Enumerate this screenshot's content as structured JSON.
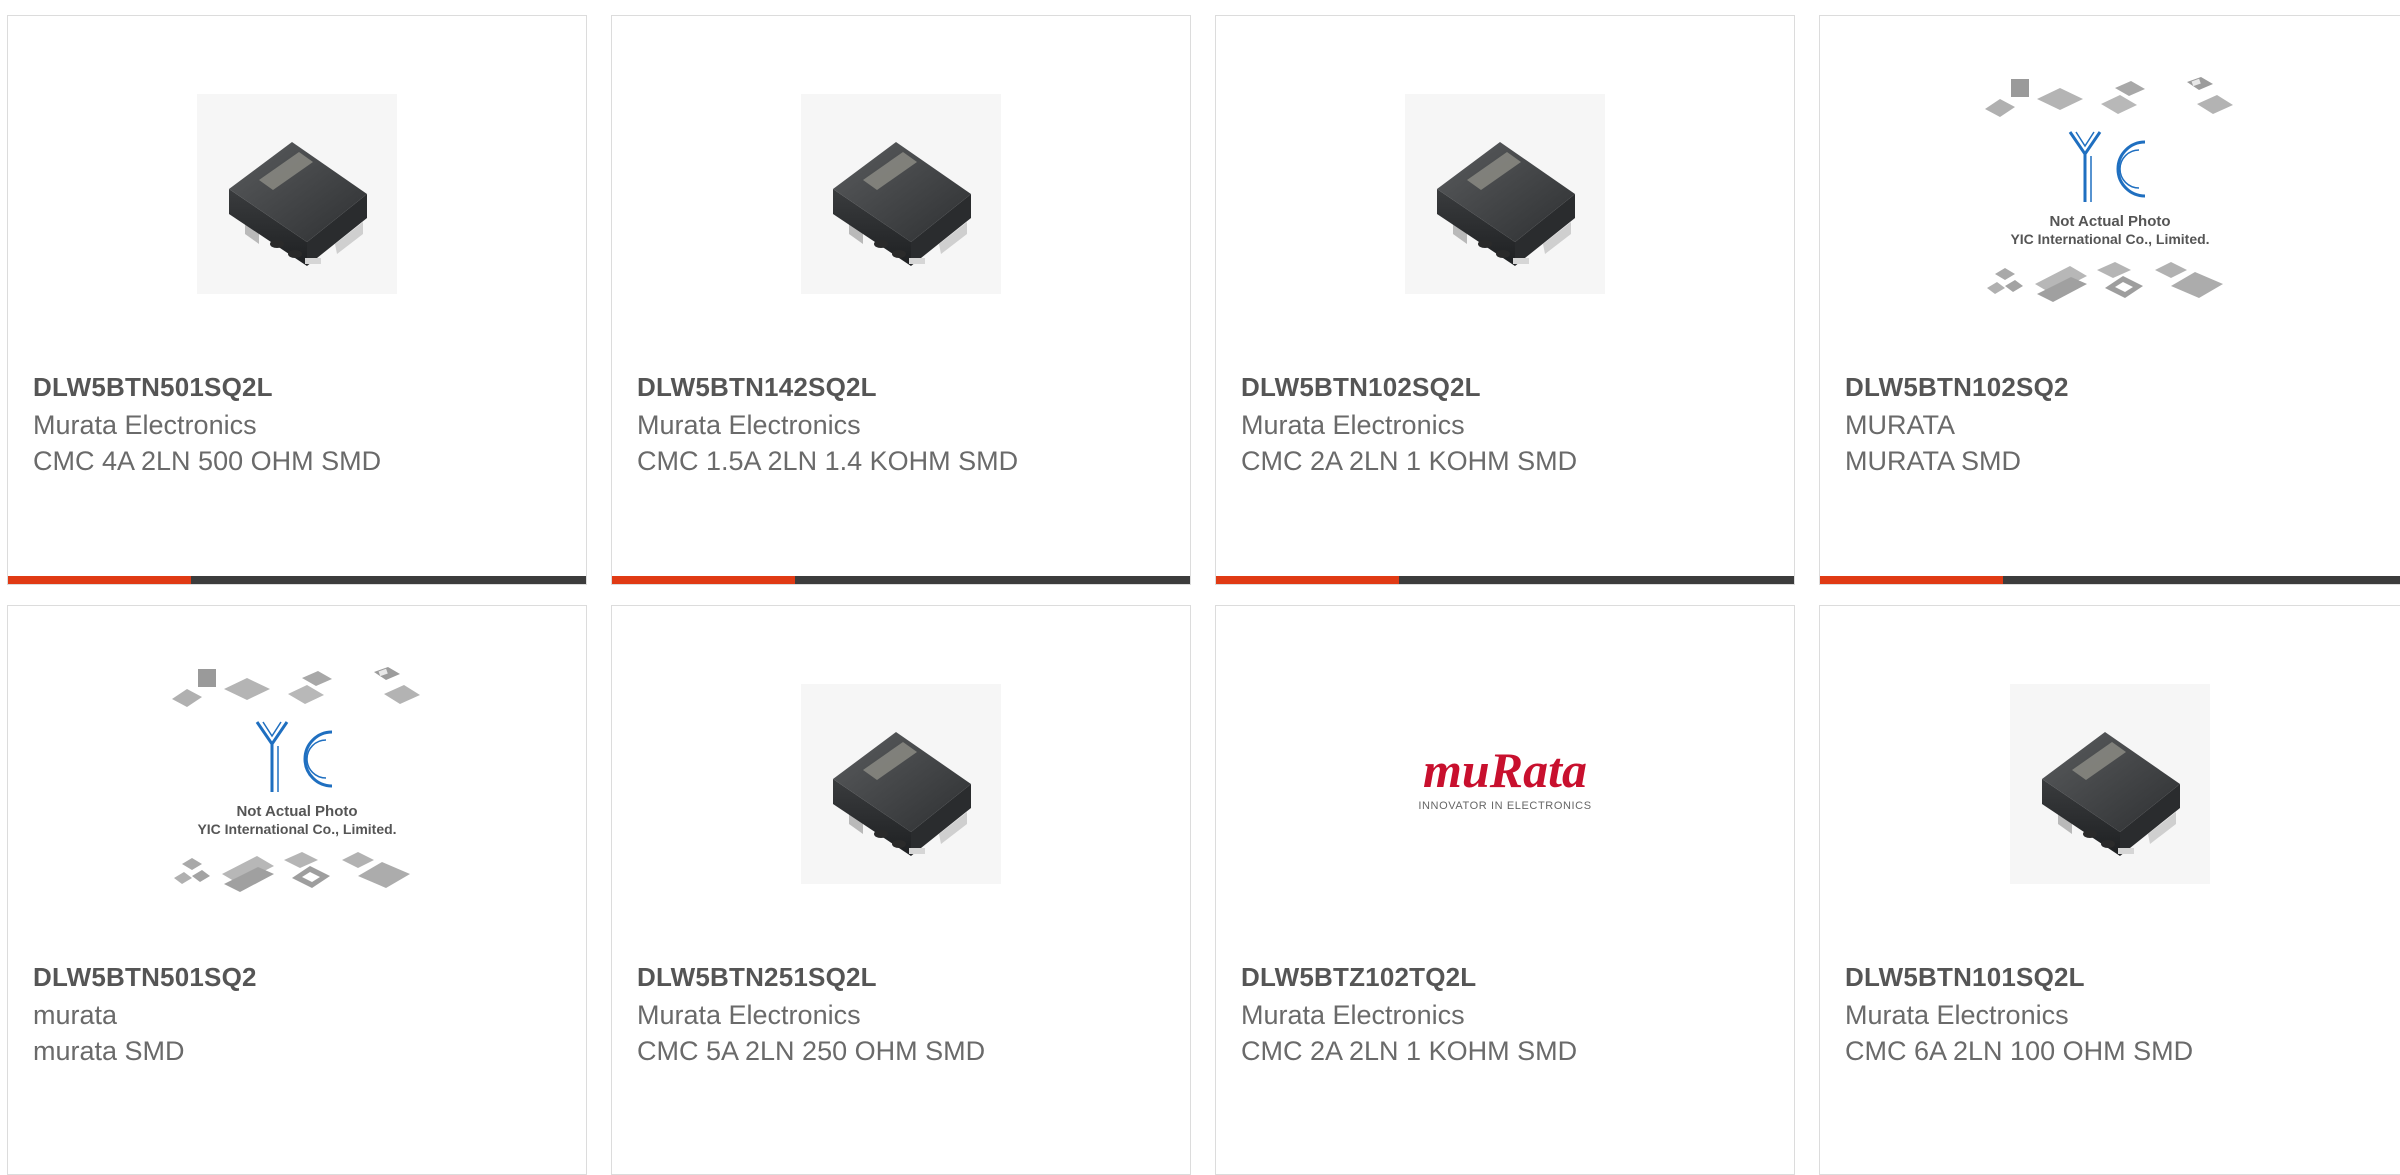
{
  "colors": {
    "accent": "#e03a14",
    "bar_dark": "#3c3c3c",
    "border": "#dcdcdc",
    "murata_red": "#c8102e",
    "yic_blue": "#1f6fc0"
  },
  "products": [
    {
      "part_number": "DLW5BTN501SQ2L",
      "manufacturer": "Murata Electronics",
      "description": "CMC 4A 2LN 500 OHM SMD",
      "image": "inductor-chip-photo"
    },
    {
      "part_number": "DLW5BTN142SQ2L",
      "manufacturer": "Murata Electronics",
      "description": "CMC 1.5A 2LN 1.4 KOHM SMD",
      "image": "inductor-chip-photo"
    },
    {
      "part_number": "DLW5BTN102SQ2L",
      "manufacturer": "Murata Electronics",
      "description": "CMC 2A 2LN 1 KOHM SMD",
      "image": "inductor-chip-photo"
    },
    {
      "part_number": "DLW5BTN102SQ2",
      "manufacturer": "MURATA",
      "description": "MURATA SMD",
      "image": "yic-placeholder",
      "image_text": {
        "logo": "YIC",
        "line1": "Not Actual Photo",
        "line2": "YIC International Co., Limited."
      }
    },
    {
      "part_number": "DLW5BTN501SQ2",
      "manufacturer": "murata",
      "description": "murata SMD",
      "image": "yic-placeholder",
      "image_text": {
        "logo": "YIC",
        "line1": "Not Actual Photo",
        "line2": "YIC International Co., Limited."
      }
    },
    {
      "part_number": "DLW5BTN251SQ2L",
      "manufacturer": "Murata Electronics",
      "description": "CMC 5A 2LN 250 OHM SMD",
      "image": "inductor-chip-photo"
    },
    {
      "part_number": "DLW5BTZ102TQ2L",
      "manufacturer": "Murata Electronics",
      "description": "CMC 2A 2LN 1 KOHM SMD",
      "image": "murata-logo",
      "image_text": {
        "brand": "muRata",
        "tagline": "INNOVATOR IN ELECTRONICS"
      }
    },
    {
      "part_number": "DLW5BTN101SQ2L",
      "manufacturer": "Murata Electronics",
      "description": "CMC 6A 2LN 100 OHM SMD",
      "image": "inductor-chip-photo"
    }
  ]
}
